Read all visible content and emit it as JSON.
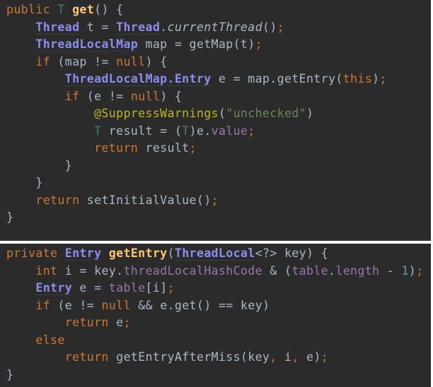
{
  "snippets": [
    {
      "name": "thread-local-get",
      "lines": [
        [
          {
            "t": "kw",
            "v": "public"
          },
          {
            "t": "plain",
            "v": " "
          },
          {
            "t": "gen",
            "v": "T"
          },
          {
            "t": "plain",
            "v": " "
          },
          {
            "t": "decl",
            "v": "get"
          },
          {
            "t": "plain",
            "v": "() {"
          }
        ],
        [
          {
            "t": "plain",
            "v": "    "
          },
          {
            "t": "type",
            "v": "Thread"
          },
          {
            "t": "plain",
            "v": " t = "
          },
          {
            "t": "type",
            "v": "Thread"
          },
          {
            "t": "plain",
            "v": "."
          },
          {
            "t": "plain it",
            "v": "currentThread"
          },
          {
            "t": "plain",
            "v": "()"
          },
          {
            "t": "punc",
            "v": ";"
          }
        ],
        [
          {
            "t": "plain",
            "v": "    "
          },
          {
            "t": "type",
            "v": "ThreadLocalMap"
          },
          {
            "t": "plain",
            "v": " map = getMap(t)"
          },
          {
            "t": "punc",
            "v": ";"
          }
        ],
        [
          {
            "t": "plain",
            "v": "    "
          },
          {
            "t": "kw",
            "v": "if"
          },
          {
            "t": "plain",
            "v": " (map != "
          },
          {
            "t": "kw",
            "v": "null"
          },
          {
            "t": "plain",
            "v": ") {"
          }
        ],
        [
          {
            "t": "plain",
            "v": "        "
          },
          {
            "t": "type",
            "v": "ThreadLocalMap.Entry"
          },
          {
            "t": "plain",
            "v": " e = map.getEntry("
          },
          {
            "t": "kw",
            "v": "this"
          },
          {
            "t": "plain",
            "v": ")"
          },
          {
            "t": "punc",
            "v": ";"
          }
        ],
        [
          {
            "t": "plain",
            "v": "        "
          },
          {
            "t": "kw",
            "v": "if"
          },
          {
            "t": "plain",
            "v": " (e != "
          },
          {
            "t": "kw",
            "v": "null"
          },
          {
            "t": "plain",
            "v": ") {"
          }
        ],
        [
          {
            "t": "plain",
            "v": "            "
          },
          {
            "t": "ann",
            "v": "@SuppressWarnings"
          },
          {
            "t": "plain",
            "v": "("
          },
          {
            "t": "str",
            "v": "\"unchecked\""
          },
          {
            "t": "plain",
            "v": ")"
          }
        ],
        [
          {
            "t": "plain",
            "v": "            "
          },
          {
            "t": "gen",
            "v": "T"
          },
          {
            "t": "plain",
            "v": " result = ("
          },
          {
            "t": "gen",
            "v": "T"
          },
          {
            "t": "plain",
            "v": ")e."
          },
          {
            "t": "fld",
            "v": "value"
          },
          {
            "t": "punc",
            "v": ";"
          }
        ],
        [
          {
            "t": "plain",
            "v": "            "
          },
          {
            "t": "kw",
            "v": "return"
          },
          {
            "t": "plain",
            "v": " result"
          },
          {
            "t": "punc",
            "v": ";"
          }
        ],
        [
          {
            "t": "plain",
            "v": "        }"
          }
        ],
        [
          {
            "t": "plain",
            "v": "    }"
          }
        ],
        [
          {
            "t": "plain",
            "v": "    "
          },
          {
            "t": "kw",
            "v": "return"
          },
          {
            "t": "plain",
            "v": " setInitialValue()"
          },
          {
            "t": "punc",
            "v": ";"
          }
        ],
        [
          {
            "t": "plain",
            "v": "}"
          }
        ]
      ]
    },
    {
      "name": "get-entry",
      "lines": [
        [
          {
            "t": "kw",
            "v": "private"
          },
          {
            "t": "plain",
            "v": " "
          },
          {
            "t": "type",
            "v": "Entry"
          },
          {
            "t": "plain",
            "v": " "
          },
          {
            "t": "decl",
            "v": "getEntry"
          },
          {
            "t": "plain",
            "v": "("
          },
          {
            "t": "type",
            "v": "ThreadLocal"
          },
          {
            "t": "plain",
            "v": "<?> key) {"
          }
        ],
        [
          {
            "t": "plain",
            "v": "    "
          },
          {
            "t": "kw",
            "v": "int"
          },
          {
            "t": "plain",
            "v": " i = key."
          },
          {
            "t": "fld",
            "v": "threadLocalHashCode"
          },
          {
            "t": "plain",
            "v": " & ("
          },
          {
            "t": "fld",
            "v": "table"
          },
          {
            "t": "plain",
            "v": "."
          },
          {
            "t": "fld",
            "v": "length"
          },
          {
            "t": "plain",
            "v": " - "
          },
          {
            "t": "num",
            "v": "1"
          },
          {
            "t": "plain",
            "v": ")"
          },
          {
            "t": "punc",
            "v": ";"
          }
        ],
        [
          {
            "t": "plain",
            "v": "    "
          },
          {
            "t": "type",
            "v": "Entry"
          },
          {
            "t": "plain",
            "v": " e = "
          },
          {
            "t": "fld",
            "v": "table"
          },
          {
            "t": "plain",
            "v": "[i]"
          },
          {
            "t": "punc",
            "v": ";"
          }
        ],
        [
          {
            "t": "plain",
            "v": "    "
          },
          {
            "t": "kw",
            "v": "if"
          },
          {
            "t": "plain",
            "v": " (e != "
          },
          {
            "t": "kw",
            "v": "null"
          },
          {
            "t": "plain",
            "v": " && e.get() == key)"
          }
        ],
        [
          {
            "t": "plain",
            "v": "        "
          },
          {
            "t": "kw",
            "v": "return"
          },
          {
            "t": "plain",
            "v": " e"
          },
          {
            "t": "punc",
            "v": ";"
          }
        ],
        [
          {
            "t": "plain",
            "v": "    "
          },
          {
            "t": "kw",
            "v": "else"
          }
        ],
        [
          {
            "t": "plain",
            "v": "        "
          },
          {
            "t": "kw",
            "v": "return"
          },
          {
            "t": "plain",
            "v": " getEntryAfterMiss(key"
          },
          {
            "t": "punc",
            "v": ","
          },
          {
            "t": "plain",
            "v": " i"
          },
          {
            "t": "punc",
            "v": ","
          },
          {
            "t": "plain",
            "v": " e)"
          },
          {
            "t": "punc",
            "v": ";"
          }
        ],
        [
          {
            "t": "plain",
            "v": "}"
          }
        ]
      ]
    }
  ],
  "colors": {
    "background": "#2b2b2b",
    "keyword": "#cc7832",
    "type": "#8d8df0",
    "generic": "#507874",
    "declaration": "#ffc66d",
    "plain": "#a9b7c6",
    "annotation": "#bbb529",
    "string": "#6a8759",
    "field": "#9876aa",
    "number": "#6897bb"
  }
}
